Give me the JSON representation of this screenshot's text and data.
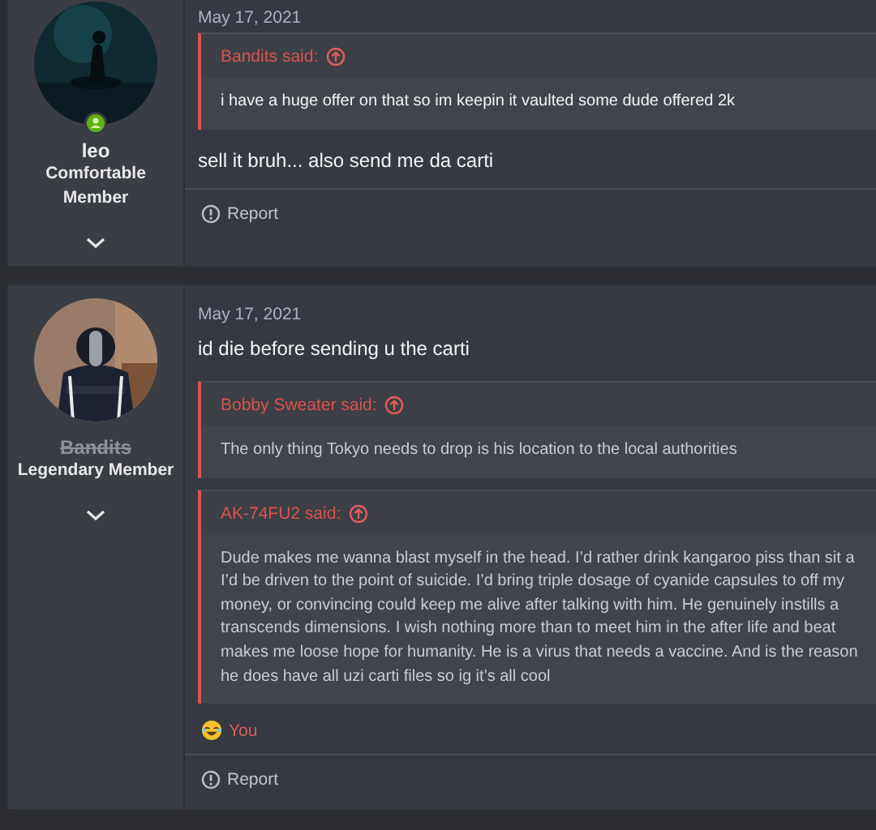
{
  "posts": [
    {
      "author": {
        "name": "leo",
        "title_lines": [
          "Comfortable",
          "Member"
        ],
        "banned": false,
        "online": true
      },
      "date": "May 17, 2021",
      "blocks": [
        {
          "kind": "quote",
          "author_line": "Bandits said:",
          "lines": [
            "i have a huge offer on that so im keepin it vaulted some dude offered 2k"
          ]
        },
        {
          "kind": "text",
          "text": "sell it bruh... also send me da carti"
        }
      ],
      "report": "Report"
    },
    {
      "author": {
        "name": "Bandits",
        "title_lines": [
          "Legendary Member"
        ],
        "banned": true
      },
      "date": "May 17, 2021",
      "blocks": [
        {
          "kind": "text",
          "text": "id die before sending u the carti"
        },
        {
          "kind": "quote",
          "author_line": "Bobby Sweater said:",
          "lines": [
            "The only thing Tokyo needs to drop is his location to the local authorities"
          ]
        },
        {
          "kind": "quote",
          "author_line": "AK-74FU2 said:",
          "lines": [
            "Dude makes me wanna blast myself in the head. I’d rather drink kangaroo piss than sit a",
            "I’d be driven to the point of suicide. I’d bring triple dosage of cyanide capsules to off my",
            "money, or convincing could keep me alive after talking with him. He genuinely instills a",
            "transcends dimensions. I wish nothing more than to meet him in the after life and beat",
            "makes me loose hope for humanity. He is a virus that needs a vaccine. And is the reason",
            "he does have all uzi carti files so ig it’s all cool"
          ]
        }
      ],
      "reactions": [
        {
          "label": "You"
        }
      ],
      "report": "Report"
    }
  ]
}
